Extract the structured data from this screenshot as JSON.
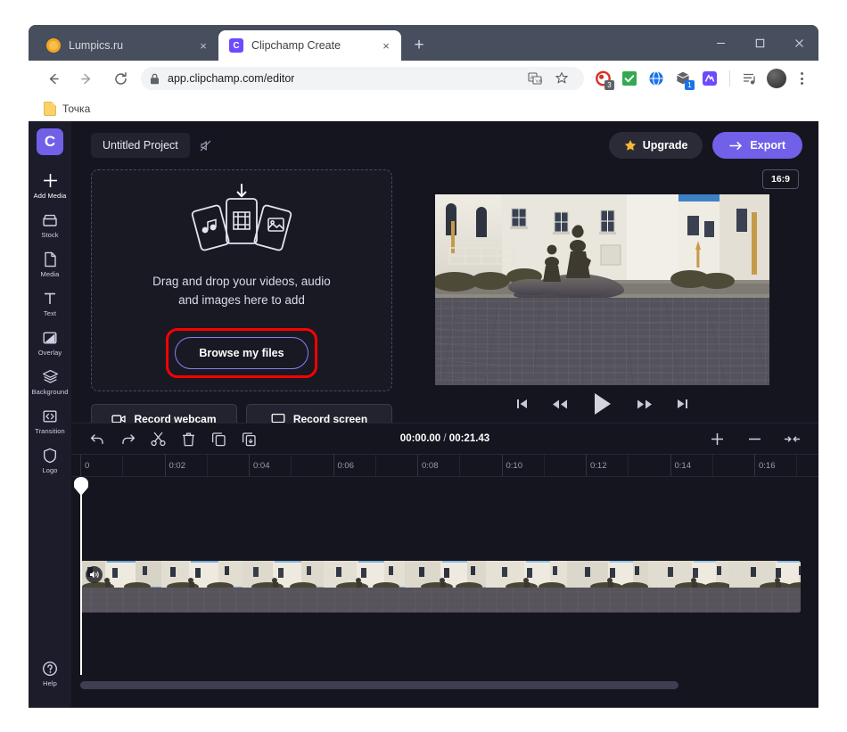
{
  "browser": {
    "tabs": [
      {
        "title": "Lumpics.ru",
        "favicon": "lumpics-favicon",
        "active": false
      },
      {
        "title": "Clipchamp Create",
        "favicon": "clipchamp-favicon",
        "active": true
      }
    ],
    "new_tab_label": "+",
    "close_label": "×",
    "window_controls": {
      "minimize": "–",
      "maximize": "□",
      "close": "✕"
    },
    "nav": {
      "back": "back-icon",
      "forward": "forward-icon",
      "reload": "reload-icon"
    },
    "omnibox": {
      "url": "app.clipchamp.com/editor",
      "lock_icon": "lock-icon",
      "translate_icon": "translate-icon",
      "bookmark_star_icon": "star-outline-icon"
    },
    "extensions": [
      {
        "name": "adblock-extension-icon",
        "badge": "3"
      },
      {
        "name": "checkmark-extension-icon",
        "badge": ""
      },
      {
        "name": "globe-extension-icon",
        "badge": ""
      },
      {
        "name": "box-extension-icon",
        "badge": "1"
      },
      {
        "name": "ad-extension-icon",
        "badge": ""
      }
    ],
    "media_icon": "media-list-icon",
    "avatar": "profile-avatar",
    "menu": "browser-menu-icon",
    "bookmarks": [
      {
        "label": "Точка",
        "icon": "note-icon"
      }
    ]
  },
  "app": {
    "logo": "C",
    "sidebar": [
      {
        "label": "Add Media",
        "icon": "plus-icon"
      },
      {
        "label": "Stock",
        "icon": "stock-icon"
      },
      {
        "label": "Media",
        "icon": "media-file-icon"
      },
      {
        "label": "Text",
        "icon": "text-icon"
      },
      {
        "label": "Overlay",
        "icon": "overlay-icon"
      },
      {
        "label": "Background",
        "icon": "layers-icon"
      },
      {
        "label": "Transition",
        "icon": "transition-icon"
      },
      {
        "label": "Logo",
        "icon": "shield-icon"
      }
    ],
    "help": {
      "label": "Help",
      "icon": "help-circle-icon"
    },
    "topbar": {
      "project_name": "Untitled Project",
      "sound_icon": "mute-icon",
      "upgrade_label": "Upgrade",
      "upgrade_icon": "star-icon",
      "export_label": "Export",
      "export_icon": "arrow-right-icon",
      "accent_color": "#7160e8"
    },
    "dropzone": {
      "icon": "add-media-cards-icon",
      "text_line1": "Drag and drop your videos, audio",
      "text_line2": "and images here to add",
      "browse_label": "Browse my files",
      "highlight_color": "#ff0000"
    },
    "record": [
      {
        "label": "Record webcam",
        "icon": "webcam-icon"
      },
      {
        "label": "Record screen",
        "icon": "monitor-icon"
      }
    ],
    "preview": {
      "aspect_ratio": "16:9",
      "description": "Video preview of a courtyard with white buildings and a bronze statue on cobblestones"
    },
    "playback": [
      {
        "name": "skip-to-start-button",
        "icon": "skip-start-icon"
      },
      {
        "name": "rewind-button",
        "icon": "rewind-icon"
      },
      {
        "name": "play-button",
        "icon": "play-icon"
      },
      {
        "name": "fast-forward-button",
        "icon": "fast-forward-icon"
      },
      {
        "name": "skip-to-end-button",
        "icon": "skip-end-icon"
      }
    ],
    "timeline": {
      "tools": [
        {
          "name": "undo-button",
          "icon": "undo-icon"
        },
        {
          "name": "redo-button",
          "icon": "redo-icon"
        },
        {
          "name": "split-button",
          "icon": "scissors-icon"
        },
        {
          "name": "delete-button",
          "icon": "trash-icon"
        },
        {
          "name": "duplicate-button",
          "icon": "copy-icon"
        },
        {
          "name": "copy-to-button",
          "icon": "copy-down-icon"
        }
      ],
      "zoom_tools": [
        {
          "name": "zoom-in-button",
          "icon": "plus-icon"
        },
        {
          "name": "zoom-out-button",
          "icon": "minus-icon"
        },
        {
          "name": "fit-timeline-button",
          "icon": "fit-arrows-icon"
        }
      ],
      "current_time": "00:00.00",
      "current_time_frac": "",
      "separator": " / ",
      "total_time": "00:21.43",
      "ruler_labels": [
        "0",
        "0:02",
        "0:04",
        "0:06",
        "0:08",
        "0:10",
        "0:12",
        "0:14",
        "0:16"
      ],
      "clip": {
        "audio_icon": "volume-icon",
        "name": "video-clip"
      },
      "playhead_position": "0"
    }
  }
}
